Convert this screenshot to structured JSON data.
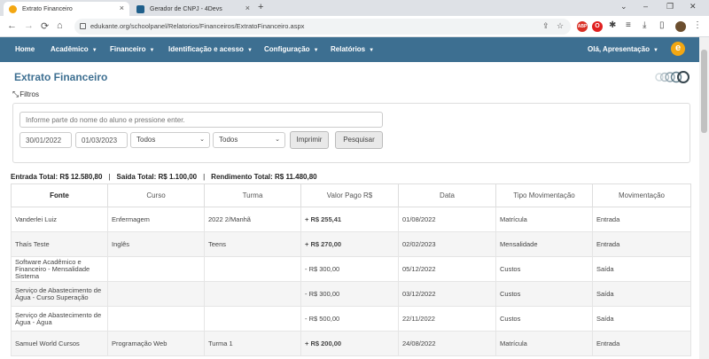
{
  "browser": {
    "tabs": [
      {
        "title": "Extrato Financeiro",
        "active": true,
        "favicon_color": "#f3a712"
      },
      {
        "title": "Gerador de CNPJ - 4Devs",
        "active": false,
        "favicon_color": "#1f5f8b"
      }
    ],
    "url": "edukante.org/schoolpanel/Relatorios/Financeiros/ExtratoFinanceiro.aspx",
    "ext_badge": "ABP"
  },
  "navbar": {
    "items": [
      {
        "label": "Home",
        "dropdown": false
      },
      {
        "label": "Acadêmico",
        "dropdown": true
      },
      {
        "label": "Financeiro",
        "dropdown": true
      },
      {
        "label": "Identificação e acesso",
        "dropdown": true
      },
      {
        "label": "Configuração",
        "dropdown": true
      },
      {
        "label": "Relatórios",
        "dropdown": true
      }
    ],
    "user": "Olá, Apresentação",
    "logo_letter": "e",
    "color": "#3d6f91"
  },
  "page": {
    "title": "Extrato Financeiro",
    "filters_label": "Filtros"
  },
  "filters": {
    "search_placeholder": "Informe parte do nome do aluno e pressione enter.",
    "date_from": "30/01/2022",
    "date_to": "01/03/2023",
    "select1": "Todos",
    "select2": "Todos",
    "print_label": "Imprimir",
    "search_label": "Pesquisar"
  },
  "totals": {
    "entrada": "Entrada Total: R$ 12.580,80",
    "saida": "Saída Total: R$ 1.100,00",
    "rendimento": "Rendimento Total: R$ 11.480,80",
    "separator": "|"
  },
  "table": {
    "headers": [
      "Fonte",
      "Curso",
      "Turma",
      "Valor Pago R$",
      "Data",
      "Tipo Movimentação",
      "Movimentação"
    ],
    "rows": [
      {
        "fonte": "Vanderlei Luiz",
        "curso": "Enfermagem",
        "turma": "2022 2/Manhã",
        "valor": "+ R$ 255,41",
        "sign": "pos",
        "data": "01/08/2022",
        "tipo": "Matrícula",
        "mov": "Entrada"
      },
      {
        "fonte": "Thaís Teste",
        "curso": "Inglês",
        "turma": "Teens",
        "valor": "+ R$ 270,00",
        "sign": "pos",
        "data": "02/02/2023",
        "tipo": "Mensalidade",
        "mov": "Entrada"
      },
      {
        "fonte": "Software Acadêmico e Financeiro - Mensalidade Sistema",
        "curso": "",
        "turma": "",
        "valor": "- R$ 300,00",
        "sign": "neg",
        "data": "05/12/2022",
        "tipo": "Custos",
        "mov": "Saída"
      },
      {
        "fonte": "Serviço de Abastecimento de Água - Curso Superação",
        "curso": "",
        "turma": "",
        "valor": "- R$ 300,00",
        "sign": "neg",
        "data": "03/12/2022",
        "tipo": "Custos",
        "mov": "Saída"
      },
      {
        "fonte": "Serviço de Abastecimento de Água - Água",
        "curso": "",
        "turma": "",
        "valor": "- R$ 500,00",
        "sign": "neg",
        "data": "22/11/2022",
        "tipo": "Custos",
        "mov": "Saída"
      },
      {
        "fonte": "Samuel World Cursos",
        "curso": "Programação Web",
        "turma": "Turma 1",
        "valor": "+ R$ 200,00",
        "sign": "pos",
        "data": "24/08/2022",
        "tipo": "Matrícula",
        "mov": "Entrada"
      }
    ]
  }
}
